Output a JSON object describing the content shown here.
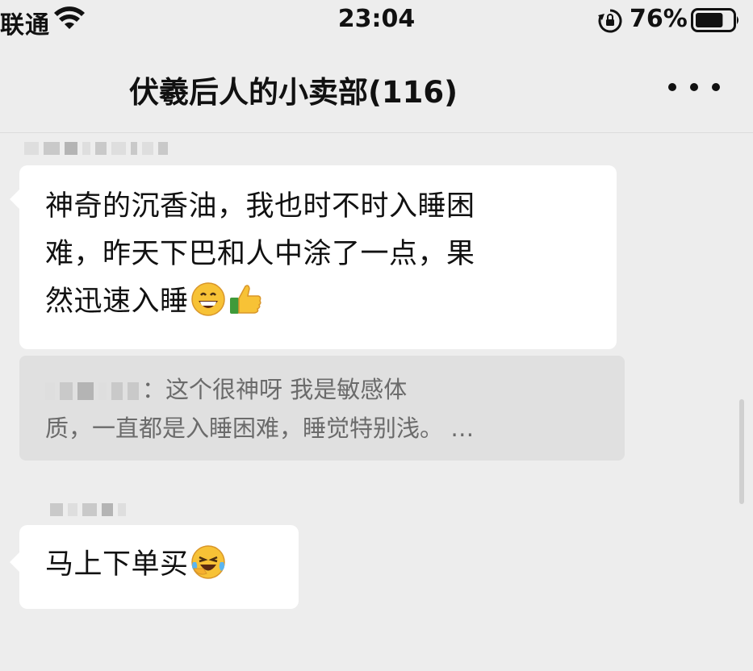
{
  "status_bar": {
    "carrier": "联通",
    "time": "23:04",
    "battery_percent": "76%",
    "battery_level": 0.76,
    "icons": [
      "wifi-icon",
      "rotation-lock-icon",
      "battery-icon"
    ]
  },
  "nav": {
    "title": "伏羲后人的小卖部(116)",
    "more_icon": "more-dots-icon"
  },
  "messages": [
    {
      "lines": [
        "神奇的沉香油，我也时不时入睡困",
        "难，昨天下巴和人中涂了一点，果",
        "然迅速入睡"
      ],
      "emojis": [
        "grinning-face-icon",
        "thumbs-up-icon"
      ]
    },
    {
      "text": "马上下单买",
      "emojis": [
        "laughing-crying-face-icon"
      ]
    }
  ],
  "quote": {
    "separator": "：",
    "line1": "这个很神呀  我是敏感体",
    "line2": "质，一直都是入睡困难，睡觉特别浅。  …"
  },
  "colors": {
    "background": "#ededed",
    "bubble": "#ffffff",
    "quote_background": "#e0e0e0",
    "quote_text": "#6b6b6b"
  }
}
